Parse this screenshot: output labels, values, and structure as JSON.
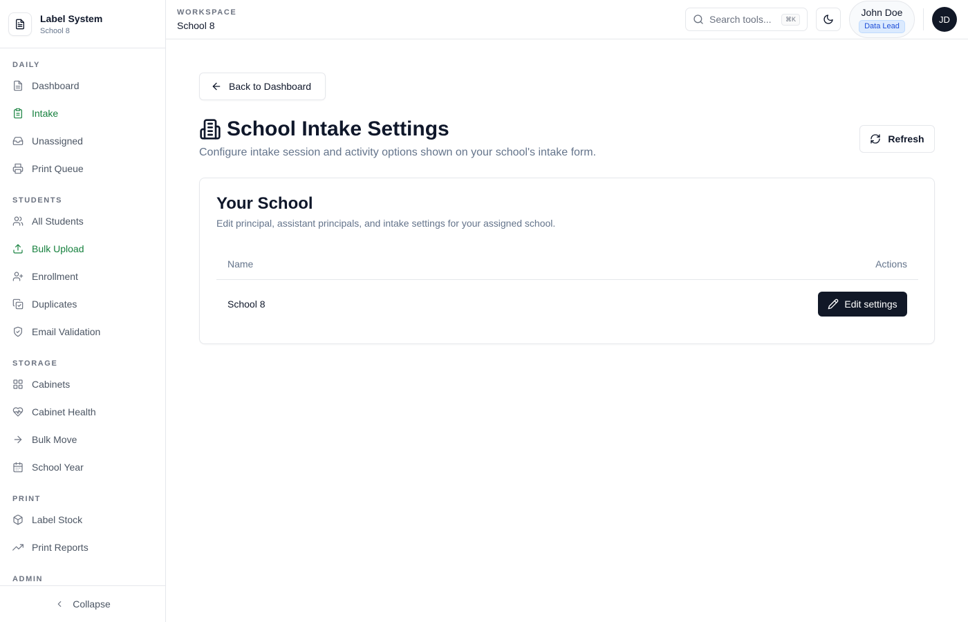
{
  "brand": {
    "title": "Label System",
    "subtitle": "School 8"
  },
  "sidebar": {
    "sections": [
      {
        "label": "DAILY",
        "items": [
          {
            "label": "Dashboard",
            "icon": "file-text-icon",
            "active": false
          },
          {
            "label": "Intake",
            "icon": "clipboard-icon",
            "active": true
          },
          {
            "label": "Unassigned",
            "icon": "inbox-icon",
            "active": false
          },
          {
            "label": "Print Queue",
            "icon": "printer-icon",
            "active": false
          }
        ]
      },
      {
        "label": "STUDENTS",
        "items": [
          {
            "label": "All Students",
            "icon": "users-icon",
            "active": false
          },
          {
            "label": "Bulk Upload",
            "icon": "upload-icon",
            "active": true
          },
          {
            "label": "Enrollment",
            "icon": "user-plus-icon",
            "active": false
          },
          {
            "label": "Duplicates",
            "icon": "copy-check-icon",
            "active": false
          },
          {
            "label": "Email Validation",
            "icon": "shield-check-icon",
            "active": false
          }
        ]
      },
      {
        "label": "STORAGE",
        "items": [
          {
            "label": "Cabinets",
            "icon": "grid-icon",
            "active": false
          },
          {
            "label": "Cabinet Health",
            "icon": "heart-pulse-icon",
            "active": false
          },
          {
            "label": "Bulk Move",
            "icon": "arrow-right-icon",
            "active": false
          },
          {
            "label": "School Year",
            "icon": "calendar-icon",
            "active": false
          }
        ]
      },
      {
        "label": "PRINT",
        "items": [
          {
            "label": "Label Stock",
            "icon": "box-icon",
            "active": false
          },
          {
            "label": "Print Reports",
            "icon": "trending-up-icon",
            "active": false
          }
        ]
      },
      {
        "label": "ADMIN",
        "items": []
      }
    ],
    "collapse_label": "Collapse"
  },
  "header": {
    "workspace_label": "WORKSPACE",
    "workspace_name": "School 8",
    "search_placeholder": "Search tools...",
    "search_shortcut": "⌘K",
    "user_name": "John Doe",
    "user_role": "Data Lead",
    "avatar_initials": "JD"
  },
  "main": {
    "back_label": "Back to Dashboard",
    "title": "School Intake Settings",
    "subtitle": "Configure intake session and activity options shown on your school's intake form.",
    "refresh_label": "Refresh",
    "card": {
      "title": "Your School",
      "subtitle": "Edit principal, assistant principals, and intake settings for your assigned school.",
      "columns": [
        "Name",
        "Actions"
      ],
      "rows": [
        {
          "name": "School 8",
          "action_label": "Edit settings"
        }
      ]
    }
  },
  "colors": {
    "accent_green": "#15803d",
    "dark_button": "#111827",
    "badge_blue": "#1d4ed8"
  }
}
